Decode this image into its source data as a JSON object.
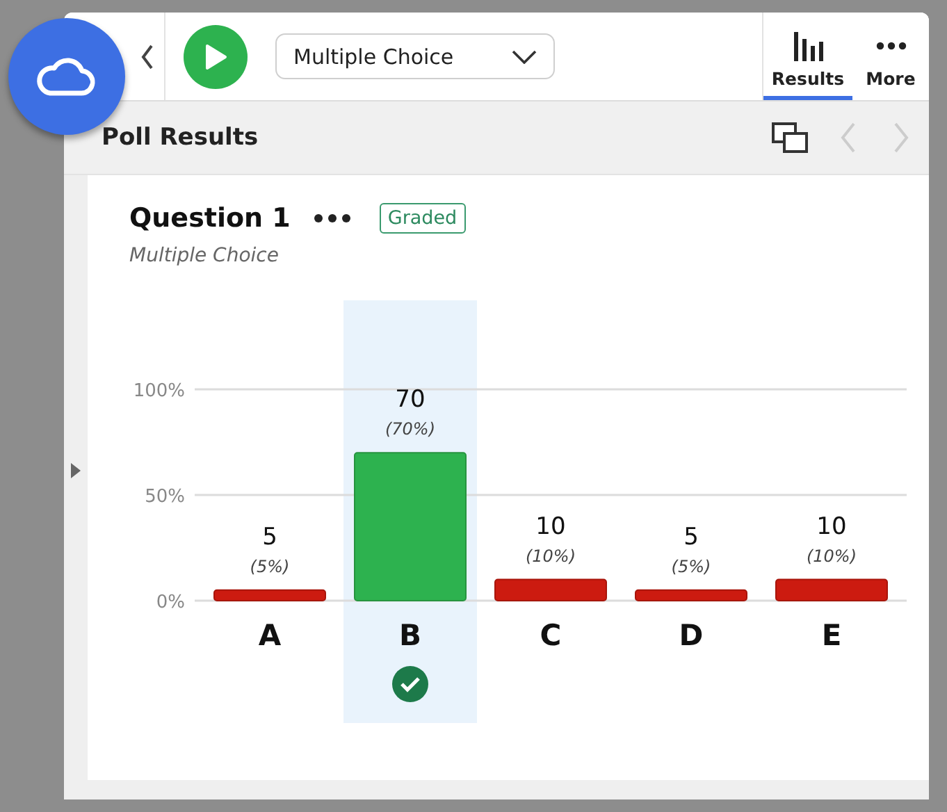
{
  "toolbar": {
    "question_type": "Multiple Choice",
    "tabs": [
      {
        "label": "Results",
        "kind": "chart",
        "selected": true
      },
      {
        "label": "More",
        "kind": "dots",
        "selected": false
      }
    ]
  },
  "header": {
    "title": "Poll Results"
  },
  "question": {
    "title": "Question 1",
    "badge": "Graded",
    "subtitle": "Multiple Choice"
  },
  "answers": [
    {
      "count": "5",
      "percent": "(5%)",
      "correct": false
    },
    {
      "count": "70",
      "percent": "(70%)",
      "correct": true
    },
    {
      "count": "10",
      "percent": "(10%)",
      "correct": false
    },
    {
      "count": "5",
      "percent": "(5%)",
      "correct": false
    },
    {
      "count": "10",
      "percent": "(10%)",
      "correct": false
    }
  ],
  "chart_data": {
    "type": "bar",
    "categories": [
      "A",
      "B",
      "C",
      "D",
      "E"
    ],
    "values": [
      5,
      70,
      10,
      5,
      10
    ],
    "ylim": [
      0,
      100
    ],
    "yticks": [
      {
        "value": 0,
        "label": "0%"
      },
      {
        "value": 50,
        "label": "50%"
      },
      {
        "value": 100,
        "label": "100%"
      }
    ]
  }
}
